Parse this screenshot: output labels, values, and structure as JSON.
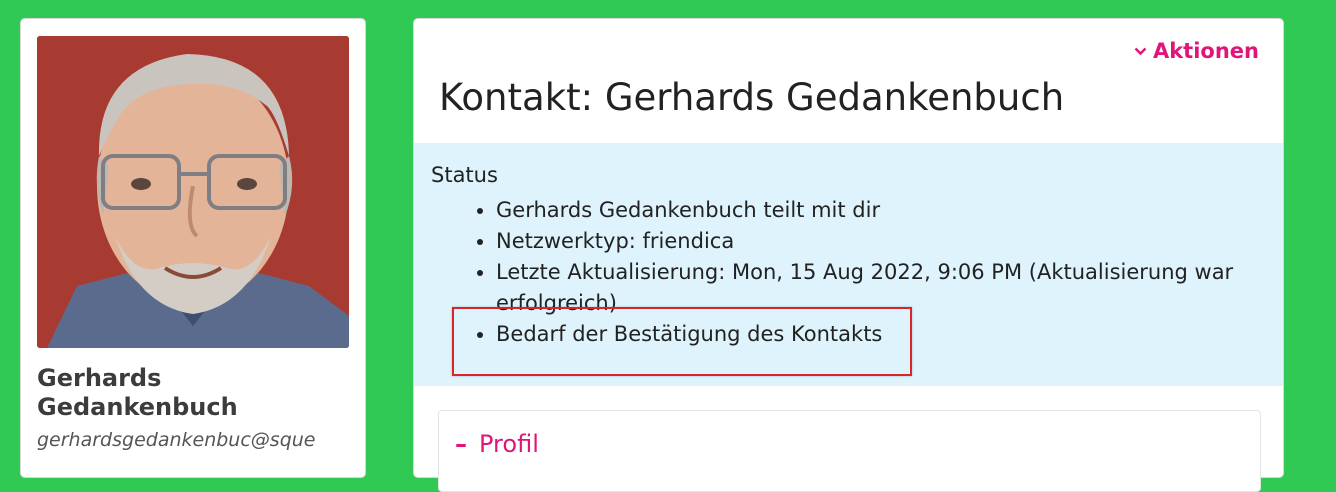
{
  "sidebar": {
    "name_line1": "Gerhards",
    "name_line2": "Gedankenbuch",
    "address": "gerhardsgedankenbuc@sque"
  },
  "main": {
    "actions_label": "Aktionen",
    "title": "Kontakt: Gerhards Gedankenbuch",
    "status": {
      "heading": "Status",
      "items": [
        "Gerhards Gedankenbuch teilt mit dir",
        "Netzwerktyp: friendica",
        "Letzte Aktualisierung: Mon, 15 Aug 2022, 9:06 PM (Aktualisierung war erfolgreich)",
        "Bedarf der Bestätigung des Kontakts"
      ]
    },
    "profile_label": "Profil"
  },
  "colors": {
    "background": "#30c954",
    "accent": "#e0157a",
    "status_bg": "#def3fc",
    "highlight": "#d9252a"
  },
  "icons": {
    "actions": "chevron-down-icon",
    "profile": "minus-icon"
  }
}
